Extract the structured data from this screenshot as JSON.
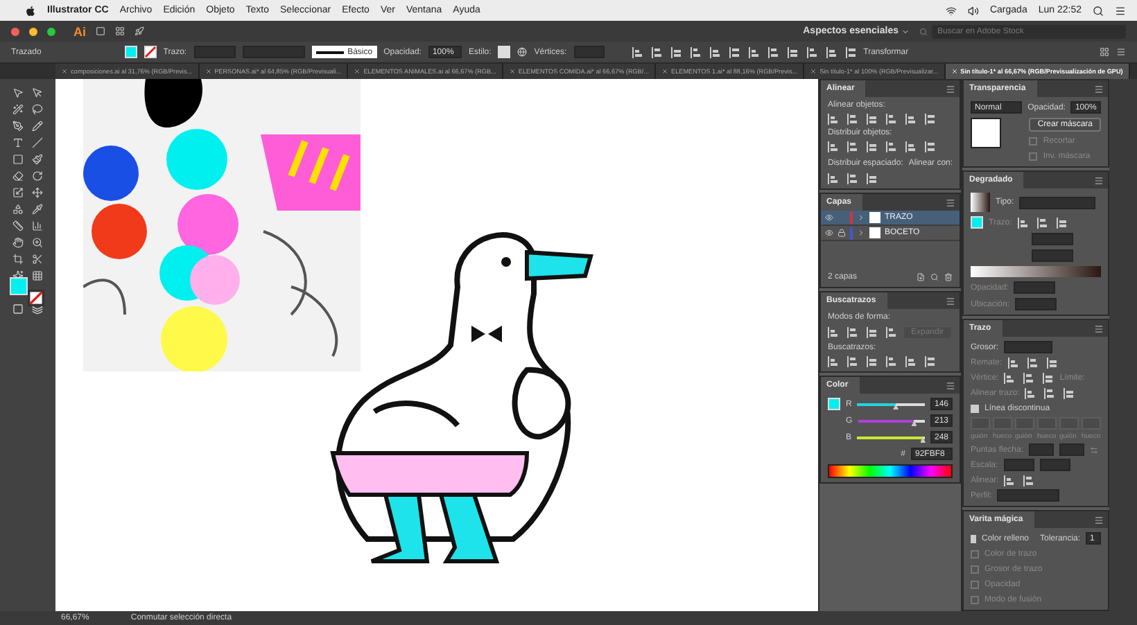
{
  "menu_bar": {
    "app": "Illustrator CC",
    "menus": [
      "Archivo",
      "Edición",
      "Objeto",
      "Texto",
      "Seleccionar",
      "Efecto",
      "Ver",
      "Ventana",
      "Ayuda"
    ],
    "battery": "Cargada",
    "clock": "Lun 22:52"
  },
  "title_bar": {
    "logo": "Ai",
    "workspace": "Aspectos esenciales",
    "search": {
      "placeholder": "Buscar en Adobe Stock"
    }
  },
  "control_bar": {
    "selection": "Trazado",
    "stroke_label": "Trazo:",
    "brush": "Básico",
    "opacity_label": "Opacidad:",
    "opacity": "100%",
    "style_label": "Estilo:",
    "vertices_label": "Vértices:",
    "transform": "Transformar"
  },
  "document_tabs": [
    {
      "label": "composiciones.ai al 31,76% (RGB/Previs...",
      "selected": false
    },
    {
      "label": "PERSONAS.ai* al 64,85% (RGB/Previsuali...",
      "selected": false
    },
    {
      "label": "ELEMENTOS ANIMALES.ai al 66,67% (RGB...",
      "selected": false
    },
    {
      "label": "ELEMENTOS COMIDA.ai* al 66,67% (RGB/...",
      "selected": false
    },
    {
      "label": "ELEMENTOS 1.ai* al 88,16% (RGB/Previs...",
      "selected": false
    },
    {
      "label": "Sin título-1* al 100% (RGB/Previsualizar...",
      "selected": false
    },
    {
      "label": "Sin título-1* al 66,67% (RGB/Previsualización de GPU)",
      "selected": true
    }
  ],
  "align_panel": {
    "title": "Alinear",
    "align_objects": "Alinear objetos:",
    "distribute_objects": "Distribuir objetos:",
    "distribute_spacing": "Distribuir espaciado:",
    "align_to": "Alinear con:"
  },
  "layers_panel": {
    "title": "Capas",
    "layers": [
      {
        "name": "TRAZO",
        "color": "#d8323c",
        "locked": false,
        "selected": true
      },
      {
        "name": "BOCETO",
        "color": "#3c5ad8",
        "locked": true,
        "selected": false
      }
    ],
    "count": "2 capas"
  },
  "pathfinder_panel": {
    "title": "Buscatrazos",
    "shape_modes": "Modos de forma:",
    "expand": "Expandir",
    "pathfinders": "Buscatrazos:"
  },
  "color_panel": {
    "title": "Color",
    "channels": [
      {
        "label": "R",
        "value": "146",
        "level": 0.57,
        "color": "#22d3e0"
      },
      {
        "label": "G",
        "value": "213",
        "level": 0.84,
        "color": "#b040d8"
      },
      {
        "label": "B",
        "value": "248",
        "level": 0.97,
        "color": "#c8e830"
      }
    ],
    "hex_label": "#",
    "hex": "92FBF8"
  },
  "transparency_panel": {
    "title": "Transparencia",
    "mode": "Normal",
    "opacity_label": "Opacidad:",
    "opacity": "100%",
    "make_mask": "Crear máscara",
    "options": [
      {
        "label": "Recortar",
        "checked": false
      },
      {
        "label": "Inv. máscara",
        "checked": false
      }
    ]
  },
  "gradient_panel": {
    "title": "Degradado",
    "type_label": "Tipo:",
    "stroke_label": "Trazo:",
    "opacity_label": "Opacidad:",
    "location_label": "Ubicación:"
  },
  "stroke_panel": {
    "title": "Trazo",
    "weight_label": "Grosor:",
    "cap_label": "Remate:",
    "corner_label": "Vértice:",
    "limit_label": "Límite:",
    "align_label": "Alinear trazo:",
    "dashed": {
      "label": "Línea discontinua",
      "checked": true
    },
    "dash_labels": [
      "guión",
      "hueco",
      "guión",
      "hueco",
      "guión",
      "hueco"
    ],
    "arrowheads_label": "Puntas flecha:",
    "scale_label": "Escala:",
    "arrow_align_label": "Alinear:",
    "profile_label": "Perfil:"
  },
  "magic_wand_panel": {
    "title": "Varita mágica",
    "tolerance_label": "Tolerancia:",
    "tolerance": "1",
    "options": [
      {
        "label": "Color relleno",
        "checked": true,
        "disabled": false
      },
      {
        "label": "Color de trazo",
        "checked": false,
        "disabled": true
      },
      {
        "label": "Grosor de trazo",
        "checked": false,
        "disabled": true
      },
      {
        "label": "Opacidad",
        "checked": false,
        "disabled": true
      },
      {
        "label": "Modo de fusión",
        "checked": false,
        "disabled": true
      }
    ]
  },
  "status_bar": {
    "zoom": "66,67%",
    "message": "Conmutar selección directa"
  }
}
